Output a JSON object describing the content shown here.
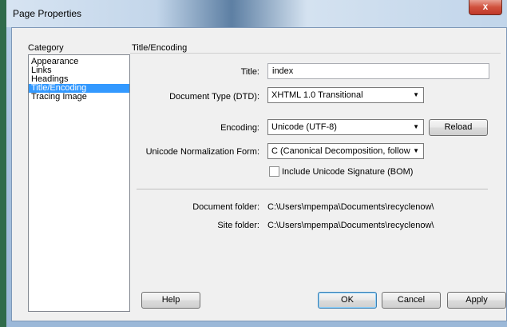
{
  "window": {
    "title": "Page Properties",
    "close_label": "x"
  },
  "category": {
    "header": "Category",
    "items": [
      {
        "label": "Appearance",
        "selected": false
      },
      {
        "label": "Links",
        "selected": false
      },
      {
        "label": "Headings",
        "selected": false
      },
      {
        "label": "Title/Encoding",
        "selected": true
      },
      {
        "label": "Tracing Image",
        "selected": false
      }
    ]
  },
  "section": {
    "title": "Title/Encoding"
  },
  "form": {
    "title_label": "Title:",
    "title_value": "index",
    "doctype_label": "Document Type (DTD):",
    "doctype_value": "XHTML 1.0 Transitional",
    "encoding_label": "Encoding:",
    "encoding_value": "Unicode (UTF-8)",
    "reload_label": "Reload",
    "normalization_label": "Unicode Normalization Form:",
    "normalization_value": "C (Canonical Decomposition, follow",
    "bom_label": "Include Unicode Signature (BOM)",
    "bom_checked": false,
    "doc_folder_label": "Document folder:",
    "doc_folder_value": "C:\\Users\\mpempa\\Documents\\recyclenow\\",
    "site_folder_label": "Site folder:",
    "site_folder_value": "C:\\Users\\mpempa\\Documents\\recyclenow\\"
  },
  "buttons": {
    "help": "Help",
    "ok": "OK",
    "cancel": "Cancel",
    "apply": "Apply"
  }
}
